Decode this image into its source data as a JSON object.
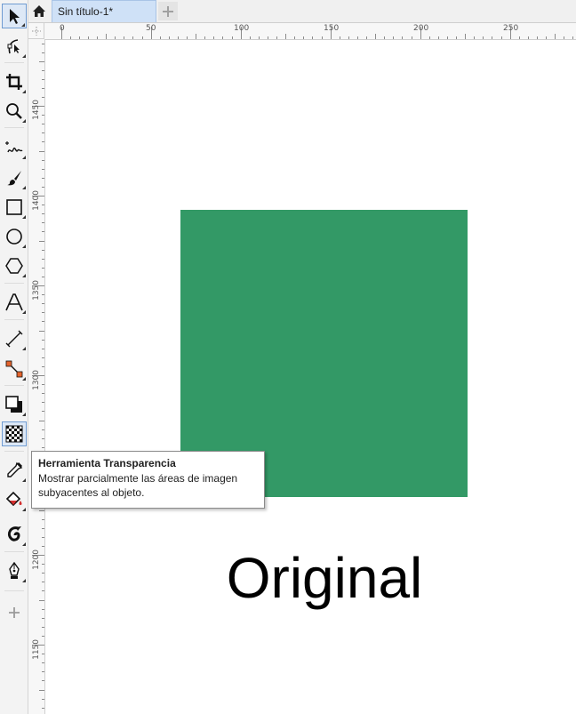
{
  "tabs": {
    "home_icon": "home-icon",
    "document_tab": "Sin título-1*",
    "add_tab_icon": "plus-icon"
  },
  "ruler": {
    "horizontal_labels": [
      "0",
      "50",
      "100",
      "150",
      "200",
      "250"
    ],
    "vertical_labels": [
      "1450",
      "1400",
      "1350",
      "1300",
      "1250",
      "1200",
      "1150"
    ]
  },
  "toolbox": {
    "tools": [
      {
        "name": "pick-tool",
        "icon": "arrow-pointer-icon"
      },
      {
        "name": "shape-tool",
        "icon": "node-edit-icon"
      },
      {
        "name": "crop-tool",
        "icon": "crop-icon"
      },
      {
        "name": "zoom-tool",
        "icon": "magnifier-icon"
      },
      {
        "name": "freehand-tool",
        "icon": "freehand-icon"
      },
      {
        "name": "artistic-media-tool",
        "icon": "brush-icon"
      },
      {
        "name": "rectangle-tool",
        "icon": "rectangle-icon"
      },
      {
        "name": "ellipse-tool",
        "icon": "ellipse-icon"
      },
      {
        "name": "polygon-tool",
        "icon": "polygon-icon"
      },
      {
        "name": "text-tool",
        "icon": "text-icon"
      },
      {
        "name": "dimension-tool",
        "icon": "dimension-icon"
      },
      {
        "name": "connector-tool",
        "icon": "connector-icon"
      },
      {
        "name": "drop-shadow-tool",
        "icon": "drop-shadow-icon"
      },
      {
        "name": "transparency-tool",
        "icon": "transparency-icon"
      },
      {
        "name": "eyedropper-tool",
        "icon": "eyedropper-icon"
      },
      {
        "name": "interactive-fill-tool",
        "icon": "fill-bucket-icon"
      },
      {
        "name": "smart-fill-tool",
        "icon": "smart-fill-icon"
      },
      {
        "name": "outline-pen-tool",
        "icon": "pen-nib-icon"
      },
      {
        "name": "add-tool",
        "icon": "plus-icon"
      }
    ]
  },
  "canvas": {
    "shape_color": "#339966",
    "label": "Original"
  },
  "tooltip": {
    "title": "Herramienta Transparencia",
    "body": "Mostrar parcialmente las áreas de imagen subyacentes al objeto."
  }
}
